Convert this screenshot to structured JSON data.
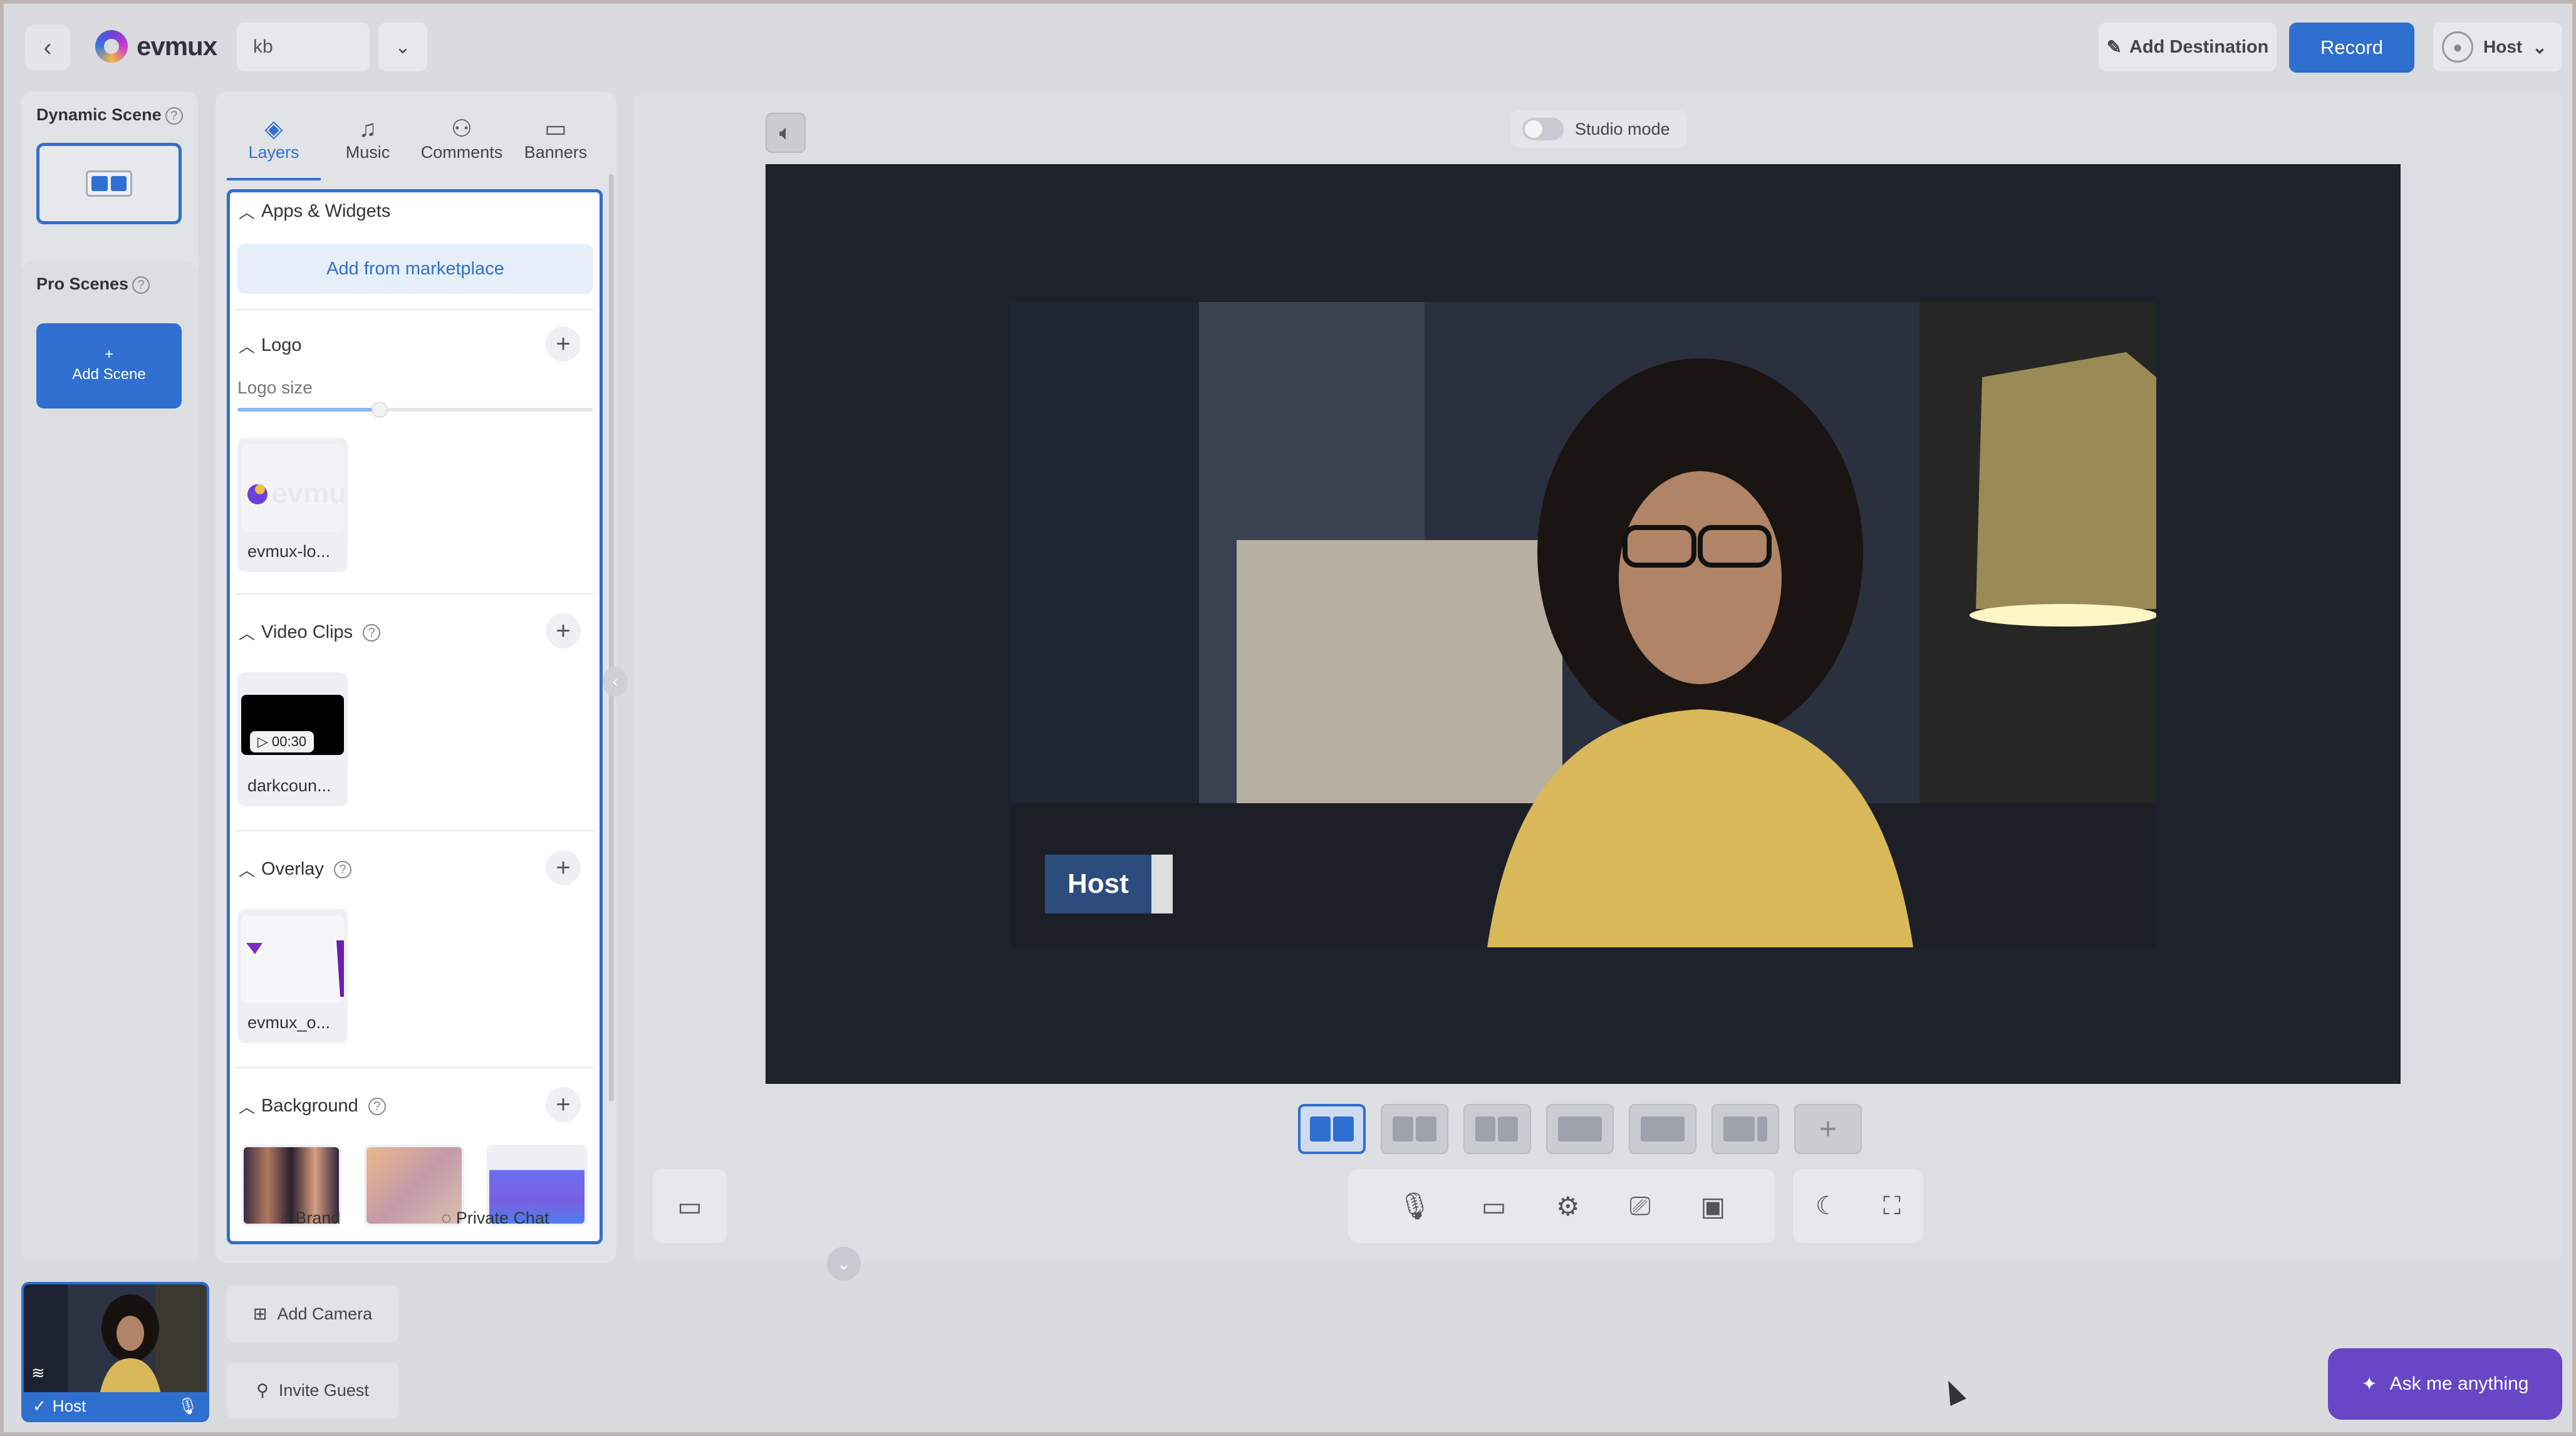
{
  "topbar": {
    "back_icon": "chevron-left-icon",
    "app_name": "evmux",
    "scene_name": "kb",
    "add_destination": "Add Destination",
    "record": "Record",
    "user": "Host"
  },
  "sidebar": {
    "dynamic_scene": "Dynamic Scene",
    "pro_scenes": "Pro Scenes",
    "add_scene_plus": "+",
    "add_scene": "Add Scene"
  },
  "panel": {
    "tabs": [
      "Layers",
      "Music",
      "Comments",
      "Banners"
    ],
    "sections": {
      "apps": "Apps & Widgets",
      "marketplace": "Add from marketplace",
      "logo": "Logo",
      "logo_size": "Logo size",
      "logo_size_value": 0.4,
      "logo_item": "evmux-lo...",
      "video_clips": "Video Clips",
      "video_item": "darkcoun...",
      "video_duration": "00:30",
      "overlay": "Overlay",
      "overlay_item": "evmux_o...",
      "background": "Background"
    },
    "bottom": [
      "Brand",
      "Private Chat"
    ]
  },
  "stage": {
    "studio_mode": "Studio mode",
    "lower_third_name": "Host"
  },
  "bottom": {
    "camera_label": "Host",
    "add_camera": "Add Camera",
    "invite_guest": "Invite Guest",
    "ask": "Ask me anything"
  },
  "colors": {
    "accent": "#2f6fd0",
    "ask_button": "#6846c6",
    "canvas": "#1d222d"
  }
}
